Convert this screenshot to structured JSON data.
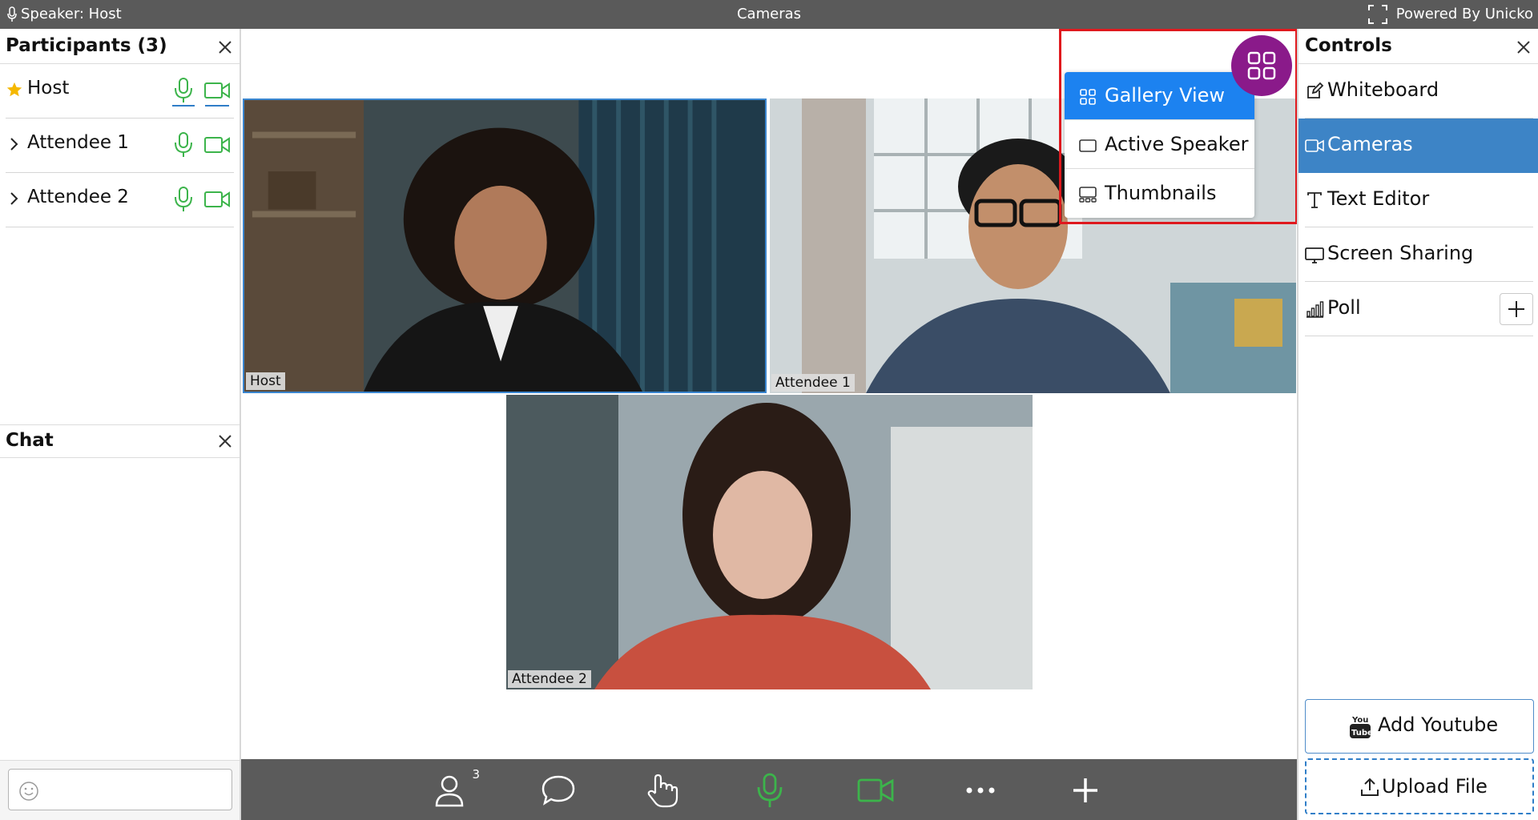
{
  "topbar": {
    "speaker_label": "Speaker: Host",
    "title": "Cameras",
    "powered_by": "Powered By Unicko"
  },
  "participants": {
    "title": "Participants (3)",
    "items": [
      {
        "name": "Host",
        "role_icon": "star-icon"
      },
      {
        "name": "Attendee 1",
        "role_icon": "chevron-right-icon"
      },
      {
        "name": "Attendee 2",
        "role_icon": "chevron-right-icon"
      }
    ]
  },
  "chat": {
    "title": "Chat",
    "input_placeholder": ""
  },
  "videos": [
    {
      "label": "Host"
    },
    {
      "label": "Attendee 1"
    },
    {
      "label": "Attendee 2"
    }
  ],
  "layout_menu": {
    "items": [
      {
        "label": "Gallery View",
        "icon": "grid-icon",
        "active": true
      },
      {
        "label": "Active Speaker",
        "icon": "rectangle-icon",
        "active": false
      },
      {
        "label": "Thumbnails",
        "icon": "thumbnails-icon",
        "active": false
      }
    ]
  },
  "controls": {
    "title": "Controls",
    "items": [
      {
        "label": "Whiteboard",
        "icon": "pencil-square-icon"
      },
      {
        "label": "Cameras",
        "icon": "camera-icon",
        "active": true
      },
      {
        "label": "Text Editor",
        "icon": "text-t-icon"
      },
      {
        "label": "Screen Sharing",
        "icon": "monitor-icon"
      },
      {
        "label": "Poll",
        "icon": "bar-chart-icon"
      }
    ],
    "add_youtube": "Add Youtube",
    "upload_file": "Upload File"
  },
  "toolbar": {
    "participants_count": "3"
  },
  "colors": {
    "accent_green": "#3cb44b",
    "accent_blue": "#1c82f0",
    "active_row": "#3d84c6",
    "fab_purple": "#8a1a8a",
    "highlight_red": "#e0191e"
  }
}
